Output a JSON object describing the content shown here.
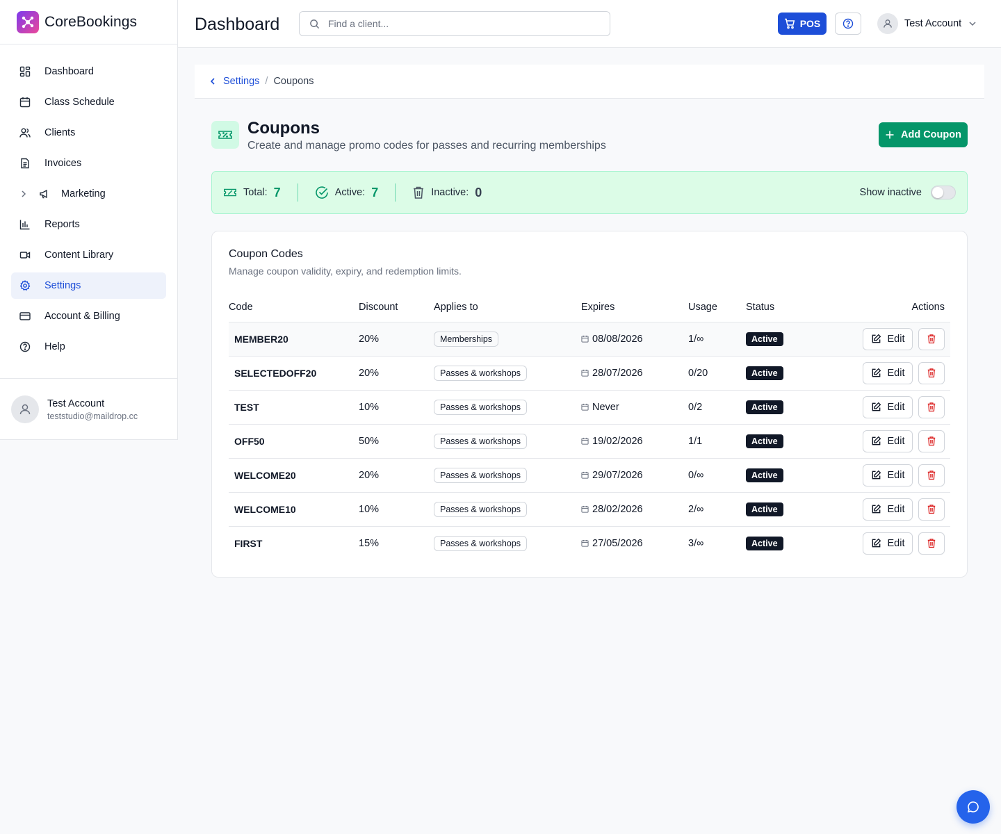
{
  "brand": {
    "name": "CoreBookings"
  },
  "sidebar": {
    "items": [
      {
        "label": "Dashboard",
        "icon": "dashboard-icon"
      },
      {
        "label": "Class Schedule",
        "icon": "calendar-icon"
      },
      {
        "label": "Clients",
        "icon": "users-icon"
      },
      {
        "label": "Invoices",
        "icon": "invoice-icon"
      },
      {
        "label": "Marketing",
        "icon": "megaphone-icon"
      },
      {
        "label": "Reports",
        "icon": "bar-chart-icon"
      },
      {
        "label": "Content Library",
        "icon": "video-icon"
      },
      {
        "label": "Settings",
        "icon": "gear-icon",
        "active": true
      },
      {
        "label": "Account & Billing",
        "icon": "credit-card-icon"
      },
      {
        "label": "Help",
        "icon": "help-circle-icon"
      }
    ],
    "user": {
      "name": "Test Account",
      "email": "teststudio@maildrop.cc"
    }
  },
  "header": {
    "title": "Dashboard",
    "search_placeholder": "Find a client...",
    "pos_label": "POS",
    "user_name": "Test Account"
  },
  "breadcrumb": {
    "parent": "Settings",
    "separator": "/",
    "current": "Coupons"
  },
  "page": {
    "title": "Coupons",
    "subtitle": "Create and manage promo codes for passes and recurring memberships",
    "add_label": "Add Coupon"
  },
  "stats": {
    "total_label": "Total:",
    "total": "7",
    "active_label": "Active:",
    "active": "7",
    "inactive_label": "Inactive:",
    "inactive": "0",
    "show_inactive_label": "Show inactive",
    "show_inactive_on": false
  },
  "card": {
    "title": "Coupon Codes",
    "subtitle": "Manage coupon validity, expiry, and redemption limits.",
    "columns": [
      "Code",
      "Discount",
      "Applies to",
      "Expires",
      "Usage",
      "Status",
      "Actions"
    ],
    "edit_label": "Edit",
    "rows": [
      {
        "code": "MEMBER20",
        "discount": "20%",
        "applies": "Memberships",
        "expires": "08/08/2026",
        "usage": "1/∞",
        "status": "Active"
      },
      {
        "code": "SELECTEDOFF20",
        "discount": "20%",
        "applies": "Passes & workshops",
        "expires": "28/07/2026",
        "usage": "0/20",
        "status": "Active"
      },
      {
        "code": "TEST",
        "discount": "10%",
        "applies": "Passes & workshops",
        "expires": "Never",
        "usage": "0/2",
        "status": "Active"
      },
      {
        "code": "OFF50",
        "discount": "50%",
        "applies": "Passes & workshops",
        "expires": "19/02/2026",
        "usage": "1/1",
        "status": "Active"
      },
      {
        "code": "WELCOME20",
        "discount": "20%",
        "applies": "Passes & workshops",
        "expires": "29/07/2026",
        "usage": "0/∞",
        "status": "Active"
      },
      {
        "code": "WELCOME10",
        "discount": "10%",
        "applies": "Passes & workshops",
        "expires": "28/02/2026",
        "usage": "2/∞",
        "status": "Active"
      },
      {
        "code": "FIRST",
        "discount": "15%",
        "applies": "Passes & workshops",
        "expires": "27/05/2026",
        "usage": "3/∞",
        "status": "Active"
      }
    ]
  },
  "colors": {
    "primary": "#1d4ed8",
    "accent_green": "#059669",
    "danger": "#dc2626",
    "stats_bg": "#dcfce7"
  }
}
